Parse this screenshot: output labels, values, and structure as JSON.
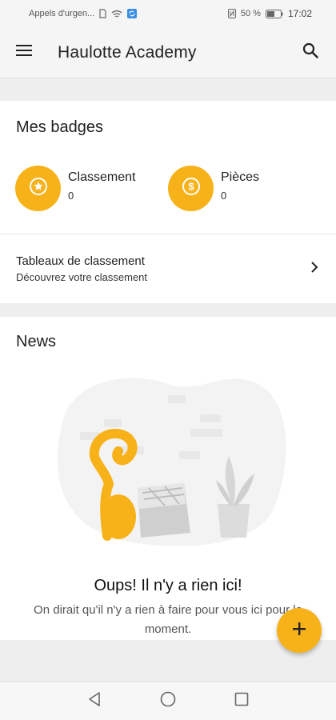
{
  "status_bar": {
    "carrier_text": "Appels d'urgen...",
    "battery_percent": "50 %",
    "time": "17:02"
  },
  "app_bar": {
    "title": "Haulotte Academy",
    "menu_icon": "menu-icon",
    "search_icon": "search-icon"
  },
  "badges": {
    "title": "Mes badges",
    "items": [
      {
        "label": "Classement",
        "value": "0",
        "icon": "star-icon"
      },
      {
        "label": "Pièces",
        "value": "0",
        "icon": "dollar-icon"
      }
    ]
  },
  "leaderboard": {
    "title": "Tableaux de classement",
    "subtitle": "Découvrez votre classement",
    "icon": "chevron-right-icon"
  },
  "news": {
    "title": "News",
    "empty_title": "Oups! Il n'y a rien ici!",
    "empty_subtitle": "On dirait qu'il n'y a rien à faire pour vous ici pour le moment."
  },
  "fab": {
    "icon": "plus-icon"
  },
  "nav_bar": {
    "icons": [
      "back-icon",
      "home-icon",
      "recents-icon"
    ]
  },
  "colors": {
    "accent": "#f7b21a",
    "background": "#eeeeee",
    "card": "#ffffff"
  }
}
